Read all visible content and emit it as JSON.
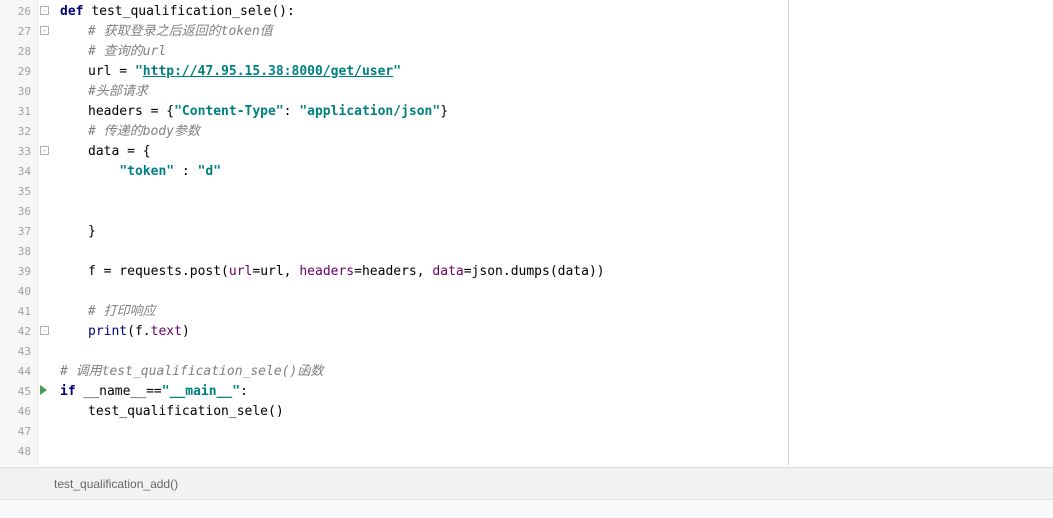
{
  "gutter": {
    "start": 26,
    "end": 48
  },
  "code": {
    "26": {
      "indent": 0,
      "tokens": [
        [
          "kw",
          "def "
        ],
        [
          "func",
          "test_qualification_sele"
        ],
        [
          "ident",
          "():"
        ]
      ]
    },
    "27": {
      "indent": 1,
      "tokens": [
        [
          "comment",
          "# 获取登录之后返回的token值"
        ]
      ]
    },
    "28": {
      "indent": 1,
      "tokens": [
        [
          "comment",
          "# 查询的url"
        ]
      ]
    },
    "29": {
      "indent": 1,
      "tokens": [
        [
          "ident",
          "url = "
        ],
        [
          "str",
          "\""
        ],
        [
          "url-str",
          "http://47.95.15.38:8000/get/user"
        ],
        [
          "str",
          "\""
        ]
      ]
    },
    "30": {
      "indent": 1,
      "tokens": [
        [
          "comment",
          "#头部请求"
        ]
      ]
    },
    "31": {
      "indent": 1,
      "tokens": [
        [
          "ident",
          "headers = {"
        ],
        [
          "str",
          "\"Content-Type\""
        ],
        [
          "ident",
          ": "
        ],
        [
          "str",
          "\"application/json\""
        ],
        [
          "ident",
          "}"
        ]
      ]
    },
    "32": {
      "indent": 1,
      "tokens": [
        [
          "comment",
          "# 传递的body参数"
        ]
      ]
    },
    "33": {
      "indent": 1,
      "tokens": [
        [
          "ident",
          "data = {"
        ]
      ]
    },
    "34": {
      "indent": 1,
      "tokens": [
        [
          "ident",
          "    "
        ],
        [
          "str",
          "\"token\""
        ],
        [
          "ident",
          " : "
        ],
        [
          "str",
          "\"d\""
        ]
      ]
    },
    "35": {
      "indent": 1,
      "tokens": []
    },
    "36": {
      "indent": 1,
      "tokens": []
    },
    "37": {
      "indent": 1,
      "tokens": [
        [
          "ident",
          "}"
        ]
      ]
    },
    "38": {
      "indent": 1,
      "tokens": []
    },
    "39": {
      "indent": 1,
      "tokens": [
        [
          "ident",
          "f = requests.post("
        ],
        [
          "param",
          "url"
        ],
        [
          "ident",
          "=url, "
        ],
        [
          "param",
          "headers"
        ],
        [
          "ident",
          "=headers, "
        ],
        [
          "param",
          "data"
        ],
        [
          "ident",
          "=json.dumps(data))"
        ]
      ]
    },
    "40": {
      "indent": 1,
      "tokens": []
    },
    "41": {
      "indent": 1,
      "tokens": [
        [
          "comment",
          "# 打印响应"
        ]
      ]
    },
    "42": {
      "indent": 1,
      "tokens": [
        [
          "builtin",
          "print"
        ],
        [
          "ident",
          "(f."
        ],
        [
          "prop",
          "text"
        ],
        [
          "ident",
          ")"
        ]
      ]
    },
    "43": {
      "indent": 0,
      "tokens": []
    },
    "44": {
      "indent": 0,
      "tokens": [
        [
          "comment",
          "# 调用test_qualification_sele()函数"
        ]
      ]
    },
    "45": {
      "indent": 0,
      "tokens": [
        [
          "kw",
          "if "
        ],
        [
          "ident",
          "__name__=="
        ],
        [
          "str",
          "\"__main__\""
        ],
        [
          "ident",
          ":"
        ]
      ]
    },
    "46": {
      "indent": 1,
      "tokens": [
        [
          "ident",
          "test_qualification_sele()"
        ]
      ]
    },
    "47": {
      "indent": 0,
      "tokens": []
    },
    "48": {
      "indent": 0,
      "tokens": []
    }
  },
  "fold_markers": {
    "open": [
      26,
      27,
      33,
      42
    ],
    "close": []
  },
  "run_marker_line": 45,
  "breadcrumb": "test_qualification_add()"
}
